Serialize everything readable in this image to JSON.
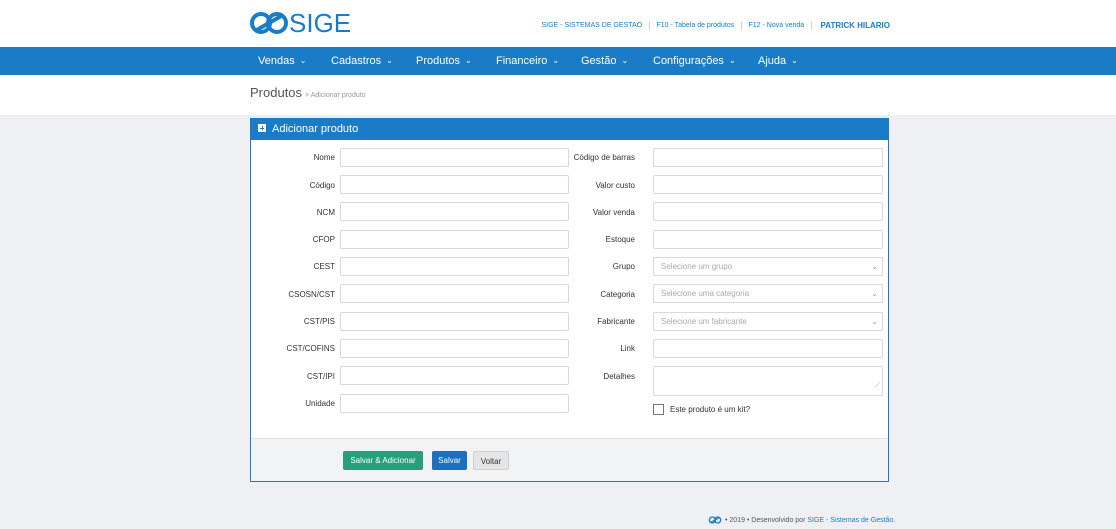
{
  "header": {
    "logo_text": "SIGE",
    "links": [
      "SIGE - SISTEMAS DE GESTAO",
      "F10 - Tabela de produtos",
      "F12 - Nova venda"
    ],
    "user": "PATRICK HILARIO",
    "brand_color": "#1a7cc7"
  },
  "nav": {
    "items": [
      "Vendas",
      "Cadastros",
      "Produtos",
      "Financeiro",
      "Gestão",
      "Configurações",
      "Ajuda"
    ],
    "chevron_icon": "⌄"
  },
  "breadcrumb": {
    "title": "Produtos",
    "sub": "> Adicionar produto"
  },
  "panel": {
    "title": "Adicionar produto",
    "left_fields": [
      {
        "label": "Nome",
        "value": ""
      },
      {
        "label": "Código",
        "value": ""
      },
      {
        "label": "NCM",
        "value": ""
      },
      {
        "label": "CFOP",
        "value": ""
      },
      {
        "label": "CEST",
        "value": ""
      },
      {
        "label": "CSOSN/CST",
        "value": ""
      },
      {
        "label": "CST/PIS",
        "value": ""
      },
      {
        "label": "CST/COFINS",
        "value": ""
      },
      {
        "label": "CST/IPI",
        "value": ""
      },
      {
        "label": "Unidade",
        "value": ""
      }
    ],
    "right_fields": [
      {
        "label": "Código de barras",
        "value": ""
      },
      {
        "label": "Valor custo",
        "value": ""
      },
      {
        "label": "Valor venda",
        "value": ""
      },
      {
        "label": "Estoque",
        "value": ""
      },
      {
        "label": "Grupo",
        "placeholder": "Selecione um grupo"
      },
      {
        "label": "Categoria",
        "placeholder": "Selecione uma categoria"
      },
      {
        "label": "Fabricante",
        "placeholder": "Selecione um fabricante"
      },
      {
        "label": "Link",
        "value": ""
      },
      {
        "label": "Detalhes",
        "value": ""
      }
    ],
    "kit_label": "Este produto é um kit?",
    "kit_checked": false,
    "buttons": {
      "save_add": "Salvar & Adicionar",
      "save": "Salvar",
      "back": "Voltar"
    }
  },
  "footer": {
    "prefix": "• 2019 • Desenvolvido por",
    "link": "SIGE - Sistemas de Gestão."
  }
}
